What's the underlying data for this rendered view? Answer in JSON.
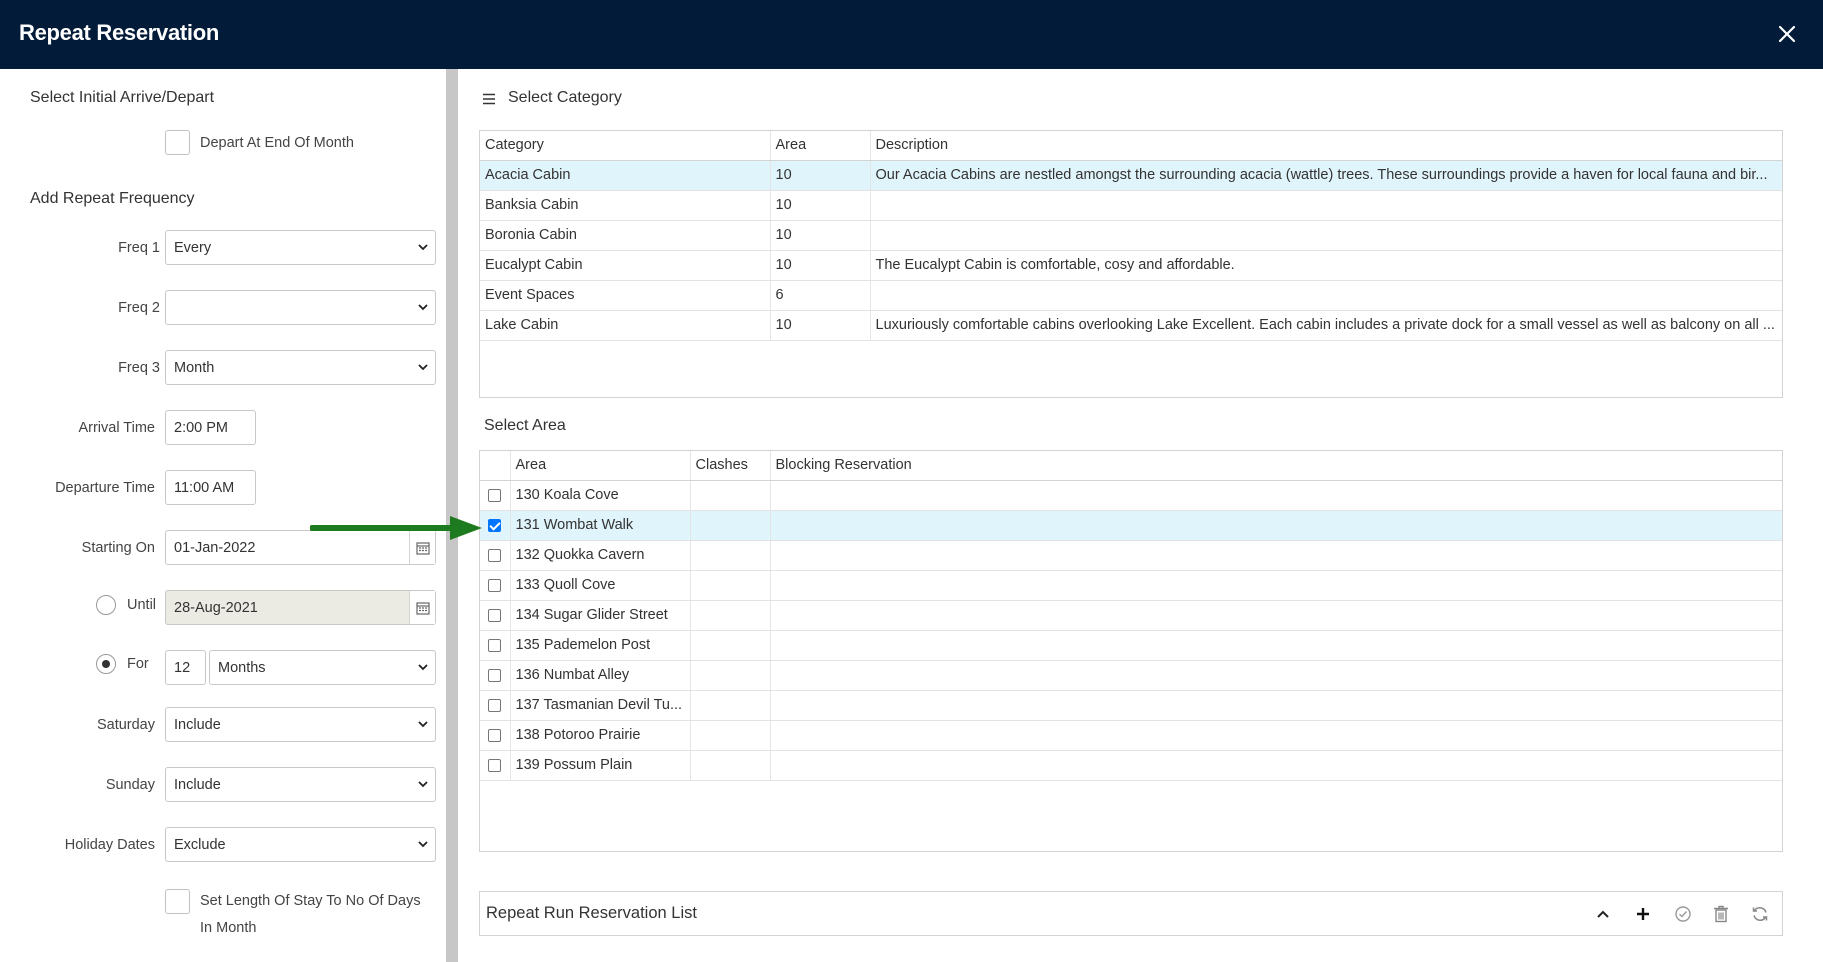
{
  "window": {
    "title": "Repeat Reservation"
  },
  "left": {
    "initial_title": "Select Initial Arrive/Depart",
    "depart_end_of_month_label": "Depart At End Of Month",
    "repeat_title": "Add Repeat Frequency",
    "freq1": {
      "label": "Freq 1",
      "value": "Every"
    },
    "freq2": {
      "label": "Freq 2",
      "value": ""
    },
    "freq3": {
      "label": "Freq 3",
      "value": "Month"
    },
    "arrival_time": {
      "label": "Arrival Time",
      "value": "2:00 PM"
    },
    "departure_time": {
      "label": "Departure Time",
      "value": "11:00 AM"
    },
    "starting_on": {
      "label": "Starting On",
      "value": "01-Jan-2022"
    },
    "until": {
      "label": "Until",
      "value": "28-Aug-2021",
      "selected": false
    },
    "for": {
      "label": "For",
      "count": "12",
      "unit": "Months",
      "selected": true
    },
    "saturday": {
      "label": "Saturday",
      "value": "Include"
    },
    "sunday": {
      "label": "Sunday",
      "value": "Include"
    },
    "holiday_dates": {
      "label": "Holiday Dates",
      "value": "Exclude"
    },
    "set_length_label_1": "Set Length Of Stay To No Of Days",
    "set_length_label_2": "In Month"
  },
  "category": {
    "title": "Select Category",
    "columns": [
      "Category",
      "Area",
      "Description"
    ],
    "rows": [
      {
        "category": "Acacia Cabin",
        "area": "10",
        "description": "Our Acacia Cabins are nestled amongst the surrounding acacia (wattle) trees. These surroundings provide a haven for local fauna and bir...",
        "selected": true
      },
      {
        "category": "Banksia Cabin",
        "area": "10",
        "description": ""
      },
      {
        "category": "Boronia Cabin",
        "area": "10",
        "description": ""
      },
      {
        "category": "Eucalypt Cabin",
        "area": "10",
        "description": "The Eucalypt Cabin is comfortable, cosy and affordable."
      },
      {
        "category": "Event Spaces",
        "area": "6",
        "description": ""
      },
      {
        "category": "Lake Cabin",
        "area": "10",
        "description": "Luxuriously comfortable cabins overlooking Lake Excellent. Each cabin includes a private dock for a small vessel as well as balcony on all ..."
      }
    ]
  },
  "area": {
    "title": "Select Area",
    "columns": [
      "Area",
      "Clashes",
      "Blocking Reservation"
    ],
    "rows": [
      {
        "area": "130 Koala Cove",
        "checked": false
      },
      {
        "area": "131 Wombat Walk",
        "checked": true
      },
      {
        "area": "132 Quokka Cavern",
        "checked": false
      },
      {
        "area": "133 Quoll Cove",
        "checked": false
      },
      {
        "area": "134 Sugar Glider Street",
        "checked": false
      },
      {
        "area": "135 Pademelon Post",
        "checked": false
      },
      {
        "area": "136 Numbat Alley",
        "checked": false
      },
      {
        "area": "137 Tasmanian Devil Tu...",
        "checked": false
      },
      {
        "area": "138 Potoroo Prairie",
        "checked": false
      },
      {
        "area": "139 Possum Plain",
        "checked": false
      }
    ]
  },
  "repeat_list": {
    "title": "Repeat Run Reservation List",
    "icons": [
      "chevron-up-icon",
      "plus-icon",
      "check-circle-icon",
      "trash-icon",
      "refresh-icon"
    ]
  },
  "colors": {
    "titlebar": "#021b38",
    "selected_row": "#e0f4fb",
    "annotation_arrow": "#1e7a1e",
    "checkbox_accent": "#0075ff"
  }
}
